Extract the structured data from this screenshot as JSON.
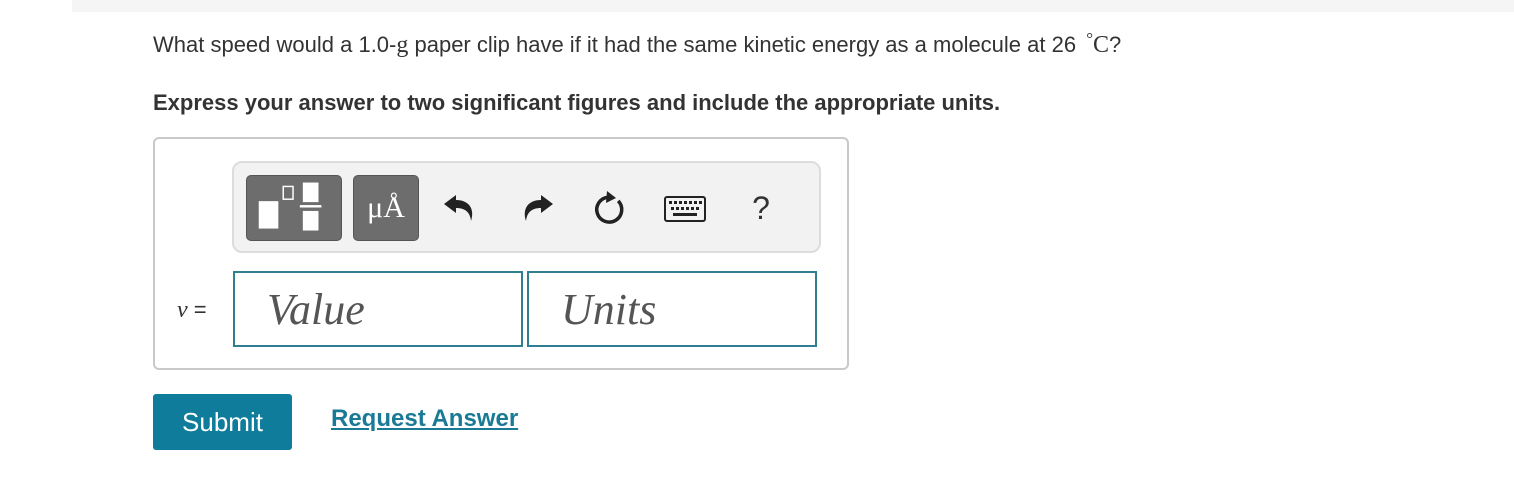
{
  "question": {
    "text_before": "What speed would a 1.0-",
    "unit_g": "g",
    "text_middle": " paper clip have if it had the same kinetic energy as a molecule at 26 ",
    "degree_symbol": "°",
    "unit_c": "C",
    "text_after": "?"
  },
  "instruction": "Express your answer to two significant figures and include the appropriate units.",
  "toolbar": {
    "templates_icon": "templates-icon",
    "units_label": "μÅ",
    "undo_icon": "undo-icon",
    "redo_icon": "redo-icon",
    "reset_icon": "reset-icon",
    "keyboard_icon": "keyboard-icon",
    "help_label": "?"
  },
  "answer": {
    "variable": "v",
    "equals": " =",
    "value_placeholder": "Value",
    "units_placeholder": "Units"
  },
  "actions": {
    "submit_label": "Submit",
    "request_answer_label": "Request Answer"
  },
  "colors": {
    "accent": "#0e7c9a",
    "link": "#1a7a96",
    "field_border": "#2f7f92",
    "toolbar_button": "#6d6d6d"
  }
}
